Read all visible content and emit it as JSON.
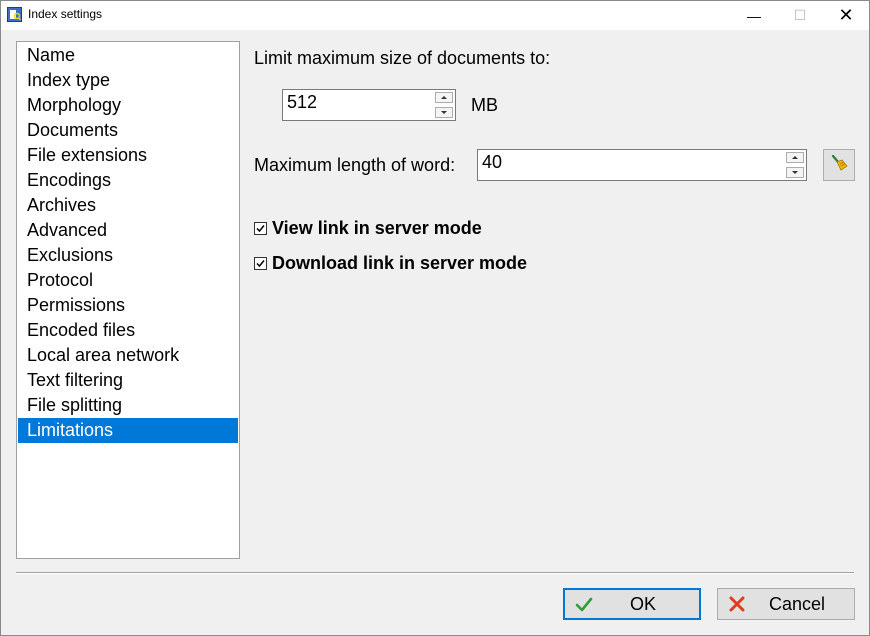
{
  "window": {
    "title": "Index settings",
    "minimize_glyph": "—",
    "maximize_glyph": "☐",
    "close_glyph": "✕"
  },
  "nav": {
    "items": [
      {
        "label": "Name"
      },
      {
        "label": "Index type"
      },
      {
        "label": "Morphology"
      },
      {
        "label": "Documents"
      },
      {
        "label": "File extensions"
      },
      {
        "label": "Encodings"
      },
      {
        "label": "Archives"
      },
      {
        "label": "Advanced"
      },
      {
        "label": "Exclusions"
      },
      {
        "label": "Protocol"
      },
      {
        "label": "Permissions"
      },
      {
        "label": "Encoded files"
      },
      {
        "label": "Local area network"
      },
      {
        "label": "Text filtering"
      },
      {
        "label": "File splitting"
      },
      {
        "label": "Limitations"
      }
    ],
    "selected_label": "Limitations"
  },
  "limits": {
    "max_size_label": "Limit maximum size of documents to:",
    "max_size_value": "512",
    "max_size_unit": "MB",
    "max_word_label": "Maximum length of word:",
    "max_word_value": "40",
    "clear_icon": "broom-icon"
  },
  "options": {
    "view_link_label": "View link in server mode",
    "view_link_checked": true,
    "download_link_label": "Download link in server mode",
    "download_link_checked": true
  },
  "buttons": {
    "ok_label": "OK",
    "ok_icon": "checkmark-icon",
    "cancel_label": "Cancel",
    "cancel_icon": "cross-icon"
  },
  "colors": {
    "selection": "#0078d7",
    "ok_check": "#2e9e3a",
    "cancel_cross": "#e03c1c"
  }
}
